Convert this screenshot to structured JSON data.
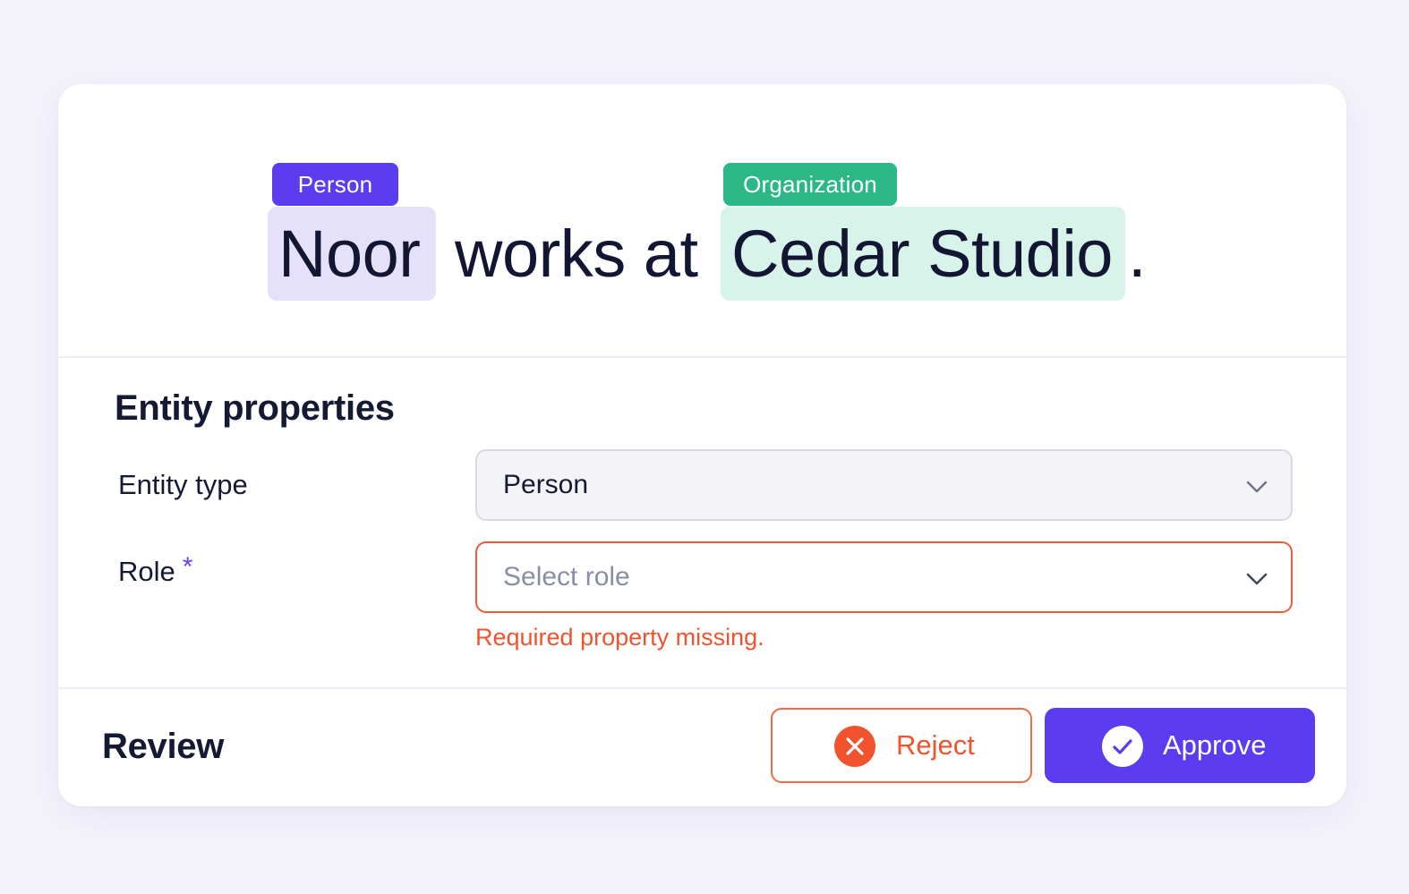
{
  "sentence": {
    "entity1_text": "Noor",
    "entity1_label": "Person",
    "middle_text": "works at",
    "entity2_text": "Cedar Studio",
    "entity2_label": "Organization",
    "end_text": "."
  },
  "properties": {
    "title": "Entity properties",
    "entity_type_label": "Entity type",
    "entity_type_value": "Person",
    "role_label": "Role",
    "role_required_marker": "*",
    "role_placeholder": "Select role",
    "role_error": "Required property missing."
  },
  "review": {
    "title": "Review",
    "reject_label": "Reject",
    "approve_label": "Approve"
  },
  "colors": {
    "person": "#5b3cf0",
    "organization": "#2bb886",
    "error": "#f0532d",
    "accent": "#5b3cf0"
  },
  "icons": {
    "select_chevron": "chevron-down-icon",
    "reject": "close-circle-icon",
    "approve": "check-circle-icon"
  }
}
